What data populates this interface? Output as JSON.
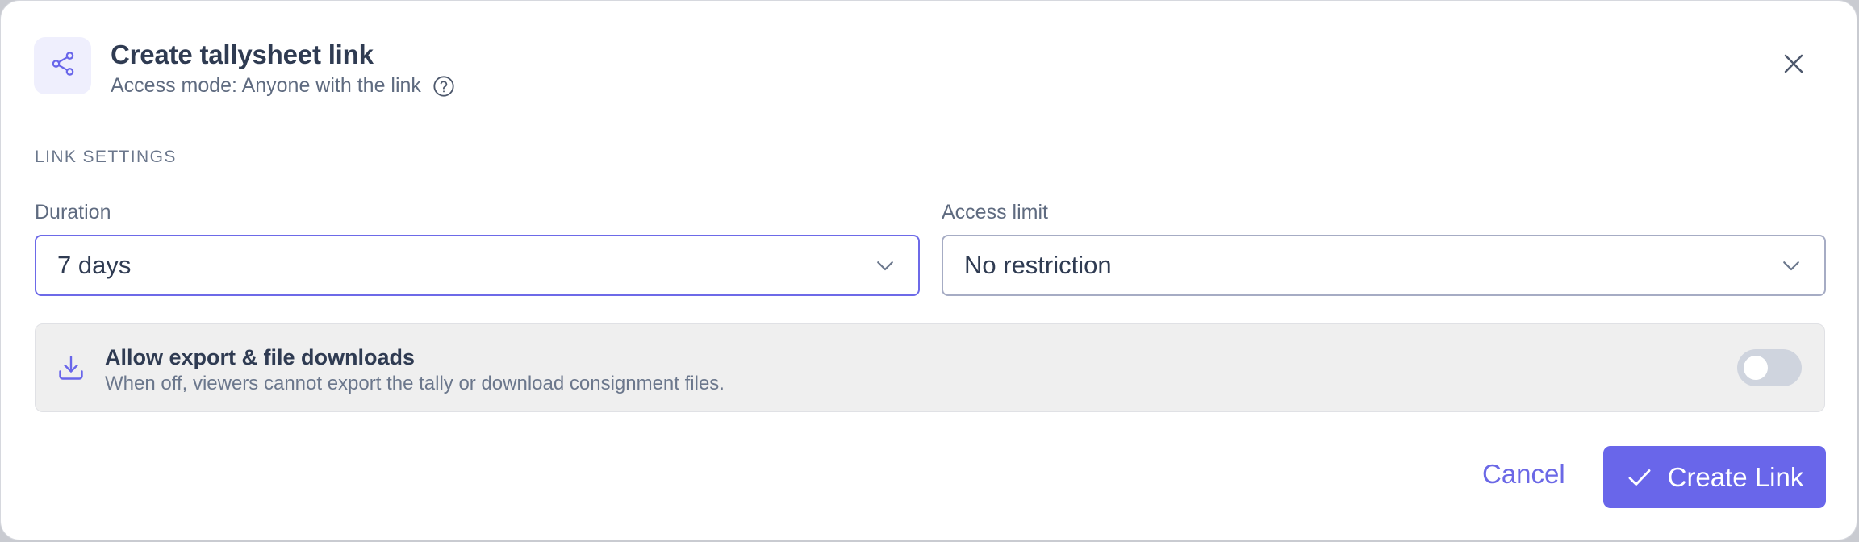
{
  "dialog": {
    "title": "Create tallysheet link",
    "subtitle": "Access mode: Anyone with the link",
    "icons": {
      "header": "share-icon",
      "help": "help-circle-icon",
      "close": "close-icon"
    }
  },
  "link_settings": {
    "section_label": "LINK SETTINGS",
    "duration": {
      "label": "Duration",
      "value": "7 days",
      "icon": "chevron-down-icon"
    },
    "access_limit": {
      "label": "Access limit",
      "value": "No restriction",
      "icon": "chevron-down-icon"
    }
  },
  "export_setting": {
    "title": "Allow export & file downloads",
    "description": "When off, viewers cannot export the tally or download consignment files.",
    "icon": "download-icon",
    "toggle_on": false
  },
  "actions": {
    "cancel_label": "Cancel",
    "create_label": "Create Link",
    "create_icon": "check-icon"
  },
  "colors": {
    "accent": "#6966ea",
    "text_primary": "#2f3b52",
    "text_secondary": "#5f6b80"
  }
}
